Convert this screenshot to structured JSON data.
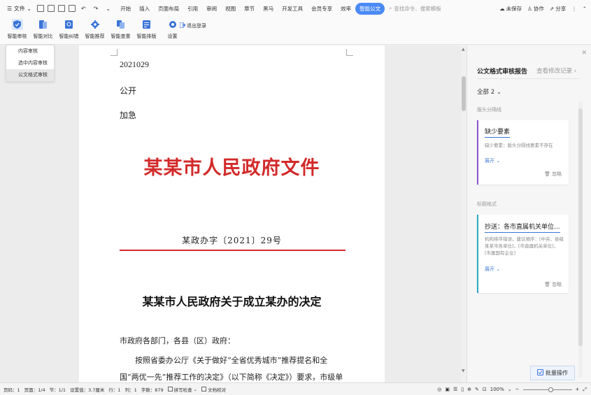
{
  "menu": {
    "file": "文件",
    "tabs": [
      "开始",
      "插入",
      "页面布局",
      "引用",
      "审阅",
      "视图",
      "章节",
      "黑马",
      "开发工具",
      "会员专享",
      "效率",
      "智能公文"
    ],
    "active_tab": 11,
    "search_placeholder": "查找命令、搜索模板",
    "unsaved": "未保存",
    "collab": "协作",
    "share": "分享"
  },
  "ribbon": {
    "items": [
      "智能审核",
      "智能对比",
      "智能纠错",
      "智能推荐",
      "智能查重",
      "智能排版",
      "设置"
    ],
    "logout": "退出登录"
  },
  "dropdown": {
    "items": [
      "内容审核",
      "选中内容审核",
      "公文格式审核"
    ],
    "selected": 2
  },
  "document": {
    "meta_lines": [
      "2021029",
      "公开",
      "加急"
    ],
    "title": "某某市人民政府文件",
    "doc_number": "某政办字〔2021〕29号",
    "heading": "某某市人民政府关于成立某办的决定",
    "salutation": "市政府各部门，各县（区）政府：",
    "body": "按照省委办公厅《关于做好“全省优秀城市”推荐提名和全国“两优一先”推荐工作的决定》（以下简称《决定》）要求，市级单位"
  },
  "panel": {
    "title": "公文格式审核报告",
    "history_link": "查看修改记录",
    "filter": "全部 2",
    "sections": [
      {
        "category": "版头分隔线",
        "title": "缺少要素",
        "desc": "缺少要素：版头分隔线要素不存在",
        "expand": "展开",
        "ignore": "忽略",
        "color": "#8a58c9"
      },
      {
        "category": "标题格式",
        "title": "抄送：各市直属机关单位...",
        "desc": "机构排序错误，建议顺序：[中央、县级某某市各单位]，[市直属机关单位]，[市属国有企业]",
        "expand": "展开",
        "ignore": "忽略",
        "color": "#2aa9c4"
      }
    ],
    "batch": "批量操作"
  },
  "status": {
    "items": [
      "页码：1",
      "页面：1/4",
      "节：1/1",
      "设置值：3.7厘米",
      "行：1",
      "列：1",
      "字数：879",
      "拼写检查",
      "文档校对"
    ],
    "zoom": "100%"
  },
  "colors": {
    "accent": "#4a8af4",
    "title_red": "#d32a2a"
  }
}
